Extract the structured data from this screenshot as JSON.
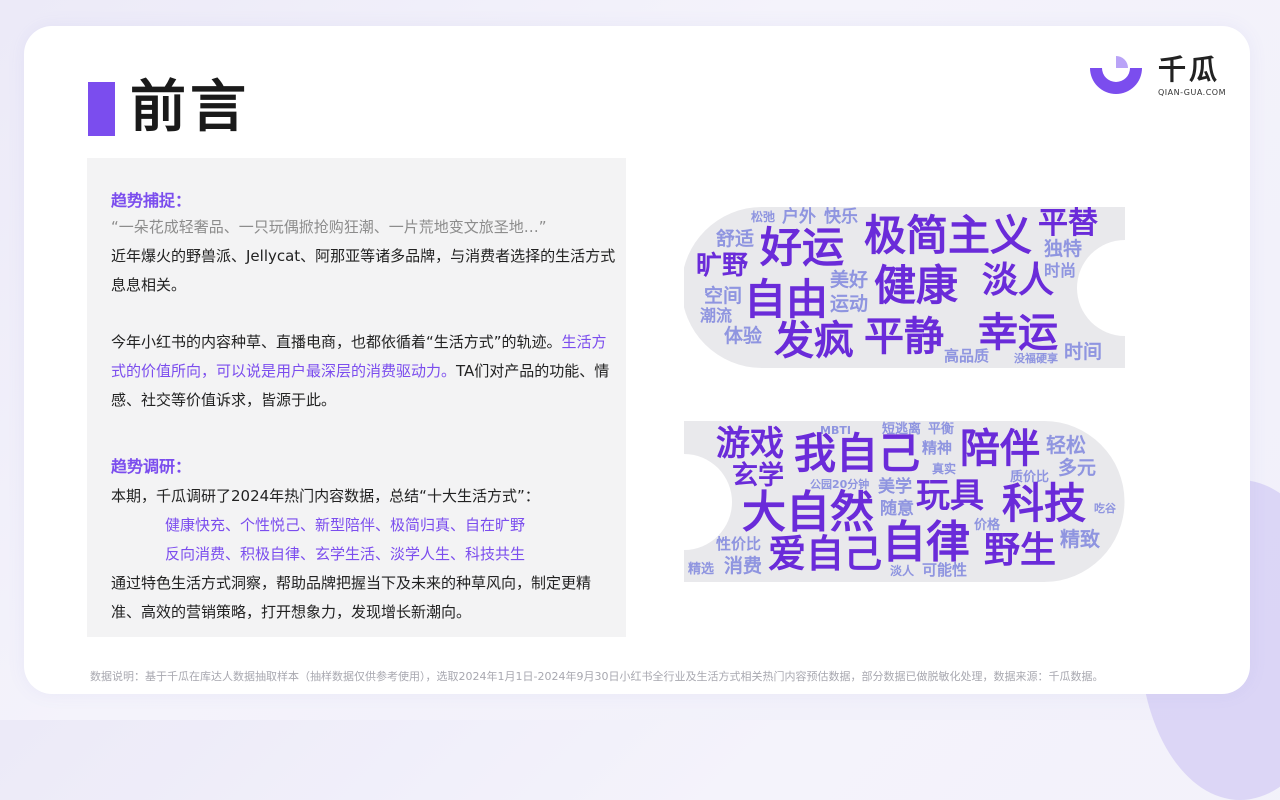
{
  "page": {
    "title": "前言",
    "footnote": "数据说明：基于千瓜在库达人数据抽取样本（抽样数据仅供参考使用），选取2024年1月1日-2024年9月30日小红书全行业及生活方式相关热门内容预估数据，部分数据已做脱敏化处理，数据来源：千瓜数据。"
  },
  "logo": {
    "cn": "千瓜",
    "en": "QIAN-GUA.COM"
  },
  "text_panel": {
    "section1_heading": "趋势捕捉：",
    "quote": "“一朵花成轻奢品、一只玩偶掀抢购狂潮、一片荒地变文旅圣地…”",
    "para1": "近年爆火的野兽派、Jellycat、阿那亚等诸多品牌，与消费者选择的生活方式息息相关。",
    "para2_normal": "今年小红书的内容种草、直播电商，也都依循着“生活方式”的轨迹。",
    "para2_highlight": "生活方式的价值所向，可以说是用户最深层的消费驱动力。",
    "para2_tail": "TA们对产品的功能、情感、社交等价值诉求，皆源于此。",
    "section2_heading": "趋势调研：",
    "para3": "本期，千瓜调研了2024年热门内容数据，总结“十大生活方式”：",
    "list_line1": "健康快充、个性悦己、新型陪伴、极简归真、自在旷野",
    "list_line2": "反向消费、积极自律、玄学生活、淡学人生、科技共生",
    "para4": "通过特色生活方式洞察，帮助品牌把握当下及未来的种草风向，制定更精准、高效的营销策略，打开想象力，发现增长新潮向。"
  },
  "colors": {
    "accent": "#7b4dee",
    "cloud_bg": "#e9e9ec"
  },
  "word_cloud_1": [
    {
      "text": "松弛",
      "color": "#8f95e0"
    },
    {
      "text": "户外",
      "color": "#8f95e0"
    },
    {
      "text": "快乐",
      "color": "#8f95e0"
    },
    {
      "text": "极简主义",
      "color": "#6a2bd9"
    },
    {
      "text": "平替",
      "color": "#6a2bd9"
    },
    {
      "text": "舒适",
      "color": "#8f95e0"
    },
    {
      "text": "好运",
      "color": "#6a2bd9"
    },
    {
      "text": "独特",
      "color": "#8f95e0"
    },
    {
      "text": "旷野",
      "color": "#6a2bd9"
    },
    {
      "text": "健康",
      "color": "#6a2bd9"
    },
    {
      "text": "淡人",
      "color": "#6a2bd9"
    },
    {
      "text": "时尚",
      "color": "#8f95e0"
    },
    {
      "text": "美好",
      "color": "#8f95e0"
    },
    {
      "text": "自由",
      "color": "#6a2bd9"
    },
    {
      "text": "空间",
      "color": "#8f95e0"
    },
    {
      "text": "运动",
      "color": "#8f95e0"
    },
    {
      "text": "潮流",
      "color": "#8f95e0"
    },
    {
      "text": "体验",
      "color": "#8f95e0"
    },
    {
      "text": "发疯",
      "color": "#6a2bd9"
    },
    {
      "text": "平静",
      "color": "#6a2bd9"
    },
    {
      "text": "幸运",
      "color": "#6a2bd9"
    },
    {
      "text": "高品质",
      "color": "#8f95e0"
    },
    {
      "text": "没福硬享",
      "color": "#8f95e0"
    },
    {
      "text": "时间",
      "color": "#8f95e0"
    }
  ],
  "word_cloud_2": [
    {
      "text": "MBTI",
      "color": "#8f95e0"
    },
    {
      "text": "短逃离",
      "color": "#8f95e0"
    },
    {
      "text": "平衡",
      "color": "#8f95e0"
    },
    {
      "text": "游戏",
      "color": "#6a2bd9"
    },
    {
      "text": "我自己",
      "color": "#6a2bd9"
    },
    {
      "text": "精神",
      "color": "#8f95e0"
    },
    {
      "text": "陪伴",
      "color": "#6a2bd9"
    },
    {
      "text": "轻松",
      "color": "#8f95e0"
    },
    {
      "text": "玄学",
      "color": "#6a2bd9"
    },
    {
      "text": "真实",
      "color": "#8f95e0"
    },
    {
      "text": "多元",
      "color": "#8f95e0"
    },
    {
      "text": "质价比",
      "color": "#8f95e0"
    },
    {
      "text": "公园20分钟",
      "color": "#8f95e0"
    },
    {
      "text": "美学",
      "color": "#8f95e0"
    },
    {
      "text": "玩具",
      "color": "#6a2bd9"
    },
    {
      "text": "科技",
      "color": "#6a2bd9"
    },
    {
      "text": "大自然",
      "color": "#6a2bd9"
    },
    {
      "text": "随意",
      "color": "#8f95e0"
    },
    {
      "text": "价格",
      "color": "#8f95e0"
    },
    {
      "text": "吃谷",
      "color": "#8f95e0"
    },
    {
      "text": "性价比",
      "color": "#8f95e0"
    },
    {
      "text": "爱自己",
      "color": "#6a2bd9"
    },
    {
      "text": "自律",
      "color": "#6a2bd9"
    },
    {
      "text": "野生",
      "color": "#6a2bd9"
    },
    {
      "text": "精致",
      "color": "#8f95e0"
    },
    {
      "text": "精选",
      "color": "#8f95e0"
    },
    {
      "text": "消费",
      "color": "#8f95e0"
    },
    {
      "text": "淡人",
      "color": "#8f95e0"
    },
    {
      "text": "可能性",
      "color": "#8f95e0"
    }
  ]
}
